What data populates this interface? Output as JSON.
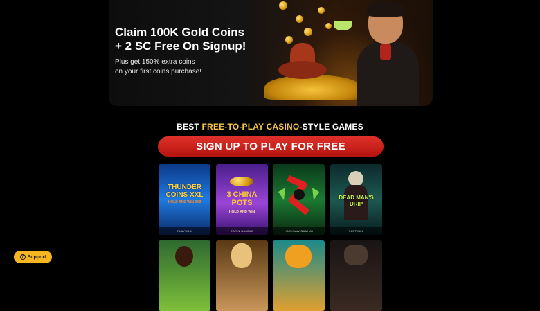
{
  "hero": {
    "title_line1": "Claim 100K Gold Coins",
    "title_line2": "+ 2 SC Free On Signup!",
    "sub_line1": "Plus get 150% extra coins",
    "sub_line2": "on your first coins purchase!"
  },
  "headline": {
    "part1": "BEST ",
    "accent": "FREE-TO-PLAY CASINO",
    "part2": "-STYLE GAMES"
  },
  "signup": {
    "label": "SIGN UP TO PLAY FOR FREE"
  },
  "games": [
    {
      "title": "THUNDER COINS XXL",
      "subtitle": "HOLD AND WIN 3X3",
      "provider": "PLAYSON"
    },
    {
      "title": "3 CHINA POTS",
      "subtitle": "HOLD AND WIN",
      "provider": "CARIN GAMING"
    },
    {
      "title": "",
      "subtitle": "",
      "provider": "HACKSAW GAMING"
    },
    {
      "title": "DEAD MAN'S DRIP",
      "subtitle": "",
      "provider": "SLOTMILL"
    },
    {
      "title": "",
      "subtitle": "",
      "provider": ""
    },
    {
      "title": "",
      "subtitle": "",
      "provider": ""
    },
    {
      "title": "",
      "subtitle": "",
      "provider": ""
    },
    {
      "title": "",
      "subtitle": "",
      "provider": ""
    }
  ],
  "support": {
    "label": "Support",
    "icon": "help-circle-icon"
  },
  "colors": {
    "accent": "#f5c542",
    "signup_red": "#d1221b",
    "support_yellow": "#f5b622"
  }
}
